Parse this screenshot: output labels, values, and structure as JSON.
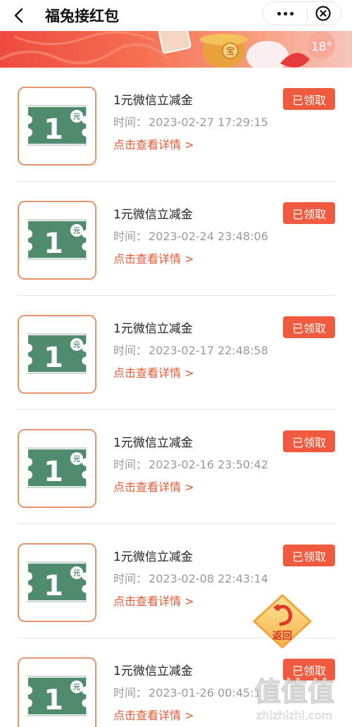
{
  "header": {
    "title": "福兔接红包"
  },
  "banner": {
    "temperature": "18°",
    "coin_label": "宝"
  },
  "coupons": [
    {
      "name": "1元微信立减金",
      "time_label": "时间：",
      "time": "2023-02-27 17:29:15",
      "detail": "点击查看详情 >",
      "status": "已领取",
      "amount": "1",
      "unit": "元"
    },
    {
      "name": "1元微信立减金",
      "time_label": "时间：",
      "time": "2023-02-24 23:48:06",
      "detail": "点击查看详情 >",
      "status": "已领取",
      "amount": "1",
      "unit": "元"
    },
    {
      "name": "1元微信立减金",
      "time_label": "时间：",
      "time": "2023-02-17 22:48:58",
      "detail": "点击查看详情 >",
      "status": "已领取",
      "amount": "1",
      "unit": "元"
    },
    {
      "name": "1元微信立减金",
      "time_label": "时间：",
      "time": "2023-02-16 23:50:42",
      "detail": "点击查看详情 >",
      "status": "已领取",
      "amount": "1",
      "unit": "元"
    },
    {
      "name": "1元微信立减金",
      "time_label": "时间：",
      "time": "2023-02-08 22:43:14",
      "detail": "点击查看详情 >",
      "status": "已领取",
      "amount": "1",
      "unit": "元"
    },
    {
      "name": "1元微信立减金",
      "time_label": "时间：",
      "time": "2023-01-26 00:45:1",
      "detail": "点击查看详情 >",
      "status": "已领取",
      "amount": "1",
      "unit": "元"
    }
  ],
  "return_button": {
    "label": "返回"
  },
  "watermark": {
    "text": "zhizhizhi.com",
    "logo_chars": "值值值"
  },
  "colors": {
    "accent": "#f05b3f",
    "detail_text": "#e35a35",
    "coupon_green": "#4f8b6d",
    "thumb_border": "#e7956b"
  }
}
